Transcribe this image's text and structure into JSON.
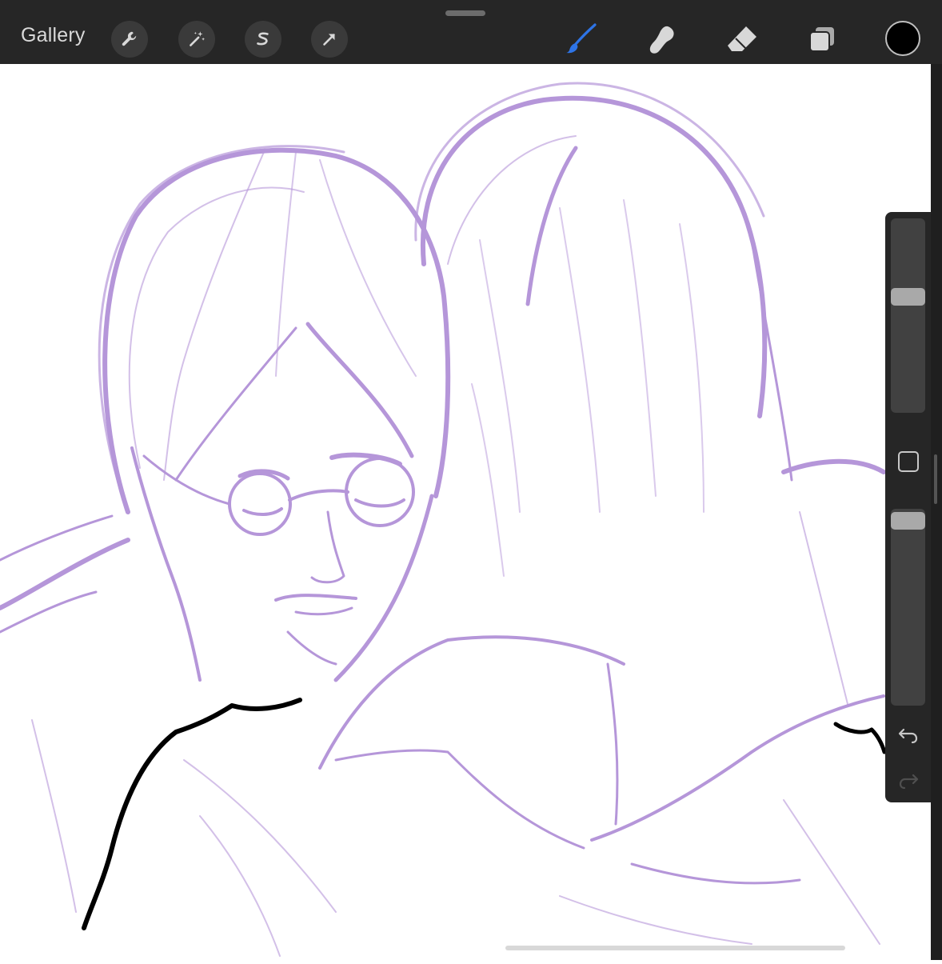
{
  "toolbar": {
    "gallery_label": "Gallery",
    "left_tools": [
      {
        "name": "actions",
        "icon": "wrench-icon"
      },
      {
        "name": "adjustments",
        "icon": "magic-wand-icon"
      },
      {
        "name": "selection",
        "icon": "selection-s-icon"
      },
      {
        "name": "transform",
        "icon": "arrow-cursor-icon"
      }
    ],
    "right_tools": [
      {
        "name": "brush",
        "icon": "brush-icon",
        "active": true
      },
      {
        "name": "smudge",
        "icon": "smudge-icon",
        "active": false
      },
      {
        "name": "eraser",
        "icon": "eraser-icon",
        "active": false
      },
      {
        "name": "layers",
        "icon": "layers-icon",
        "active": false
      }
    ],
    "current_color": "#000000",
    "active_color": "#2e74e6"
  },
  "sidebar": {
    "brush_size": 0.39,
    "brush_opacity": 0.0,
    "icons": [
      "modify-square-icon",
      "undo-icon",
      "redo-icon"
    ]
  },
  "canvas": {
    "sketch_color": "#b596d9",
    "ink_color": "#000000"
  }
}
